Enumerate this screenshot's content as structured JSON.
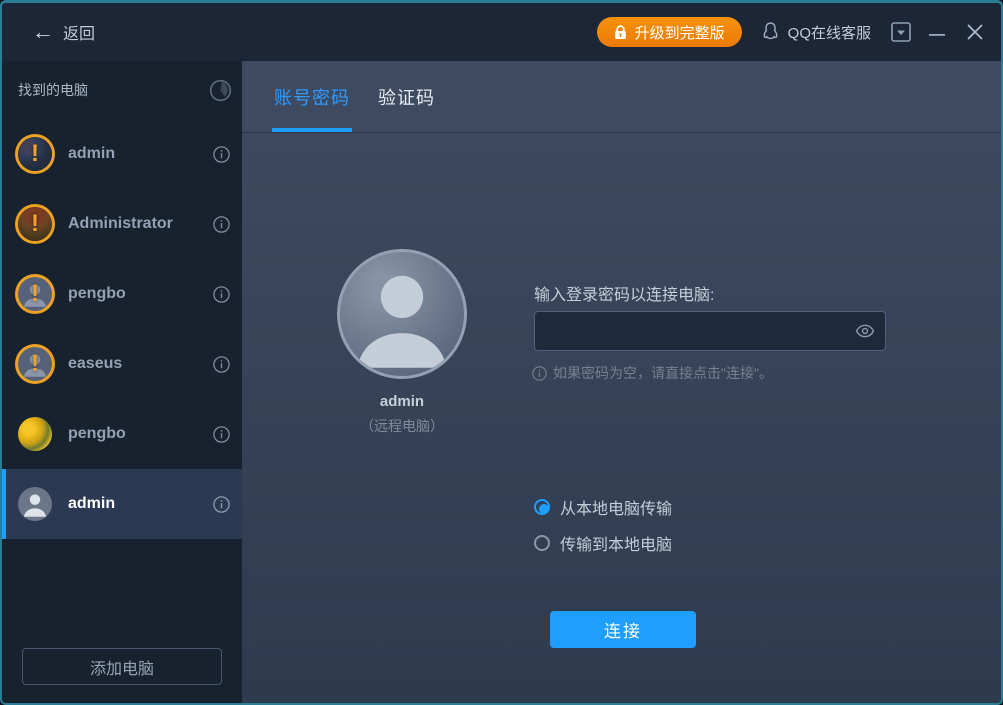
{
  "titlebar": {
    "back_label": "返回",
    "upgrade_label": "升级到完整版",
    "qq_label": "QQ在线客服"
  },
  "sidebar": {
    "header": "找到的电脑",
    "add_button_label": "添加电脑",
    "computers": [
      {
        "name": "admin",
        "avatar": "photo-dark",
        "status": "warning",
        "selected": false
      },
      {
        "name": "Administrator",
        "avatar": "photo-red",
        "status": "warning",
        "selected": false
      },
      {
        "name": "pengbo",
        "avatar": "person",
        "status": "warning",
        "selected": false
      },
      {
        "name": "easeus",
        "avatar": "person",
        "status": "warning",
        "selected": false
      },
      {
        "name": "pengbo",
        "avatar": "flowers",
        "status": "none",
        "selected": false
      },
      {
        "name": "admin",
        "avatar": "person",
        "status": "none",
        "selected": true
      }
    ]
  },
  "main": {
    "tabs": [
      {
        "label": "账号密码",
        "active": true
      },
      {
        "label": "验证码",
        "active": false
      }
    ],
    "remote_computer": {
      "name": "admin",
      "type_label": "（远程电脑）"
    },
    "password_section": {
      "label": "输入登录密码以连接电脑:",
      "input_value": "",
      "hint": "如果密码为空，请直接点击\"连接\"。"
    },
    "transfer_options": [
      {
        "label": "从本地电脑传输",
        "selected": true
      },
      {
        "label": "传输到本地电脑",
        "selected": false
      }
    ],
    "connect_button_label": "连接"
  },
  "colors": {
    "accent_blue": "#1e9fff",
    "upgrade_orange": "#f08010",
    "warning_orange": "#f0a22a",
    "window_border_teal": "#2b7e95",
    "sidebar_bg": "#18222f",
    "content_bg": "#3d495e"
  }
}
